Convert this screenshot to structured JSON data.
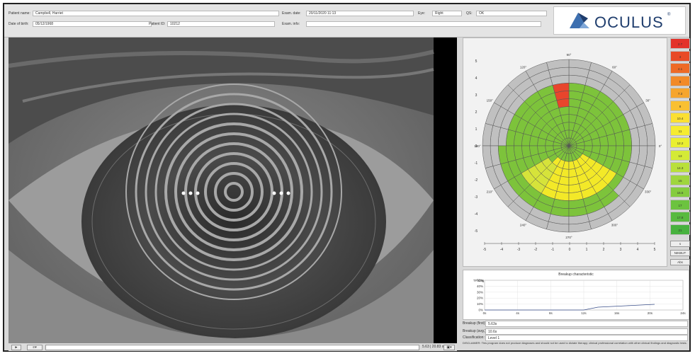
{
  "header": {
    "patient_name_label": "Patient name:",
    "patient_name": "Campbell, Harriet",
    "dob_label": "Date of birth:",
    "dob": "05/12/1968",
    "patient_id_label": "Patient ID:",
    "patient_id": "10212",
    "exam_date_label": "Exam. date:",
    "exam_date": "20/11/2020 11:13",
    "eye_label": "Eye:",
    "eye": "Right",
    "qs_label": "QS:",
    "qs": "OK",
    "exam_info_label": "Exam. info:",
    "exam_info": ""
  },
  "logo": {
    "text": "OCULUS",
    "reg": "®"
  },
  "image_toolbar": {
    "play_label": "►",
    "menu_label": "≡▾",
    "info": "5.63 | 20.83 s",
    "save_label": "▣▾"
  },
  "map": {
    "angle_labels": [
      "0°",
      "30°",
      "60°",
      "90°",
      "120°",
      "150°",
      "180°",
      "210°",
      "240°",
      "270°",
      "300°",
      "330°"
    ],
    "axis_ticks": [
      "-5",
      "-4",
      "-3",
      "-2",
      "-1",
      "0",
      "1",
      "2",
      "3",
      "4",
      "5"
    ],
    "rings": 11,
    "sectors": 24,
    "zone_colors": {
      "red": "#e8452c",
      "green": "#7dc33b",
      "yellow": "#f3e928",
      "light_yellow": "#d6e33a",
      "grey": "#c0c0c0"
    }
  },
  "scale": {
    "items": [
      {
        "label": "2.7",
        "color": "#e3322a"
      },
      {
        "label": "3",
        "color": "#e84a26"
      },
      {
        "label": "4.1",
        "color": "#ee6a26"
      },
      {
        "label": "5",
        "color": "#f28a28"
      },
      {
        "label": "7.3",
        "color": "#f6a52d"
      },
      {
        "label": "8",
        "color": "#f9c032"
      },
      {
        "label": "10.4",
        "color": "#fbe033"
      },
      {
        "label": "11",
        "color": "#f6ec30"
      },
      {
        "label": "12.2",
        "color": "#eaef30"
      },
      {
        "label": "13",
        "color": "#d4ea36"
      },
      {
        "label": "14.3",
        "color": "#b9e03b"
      },
      {
        "label": "15",
        "color": "#9fd63d"
      },
      {
        "label": "16.5",
        "color": "#85cc3e"
      },
      {
        "label": "17",
        "color": "#6cc33f"
      },
      {
        "label": "17.8",
        "color": "#58ba3f"
      },
      {
        "label": "21",
        "color": "#47b23e"
      }
    ],
    "buttons": [
      "s",
      "NIKBUT",
      "Abs"
    ]
  },
  "breakup": {
    "title": "Breakup characteristic",
    "ylabel": "TF-Dag",
    "y_ticks": [
      "50%",
      "40%",
      "30%",
      "20%",
      "10%",
      "0%"
    ],
    "x_ticks": [
      "0s",
      "4s",
      "8s",
      "12s",
      "16s",
      "20s",
      "24s"
    ]
  },
  "results": {
    "first_label": "Breakup (first):",
    "first_value": "5.63s",
    "avg_label": "Breakup (avg.):",
    "avg_value": "10.6s",
    "class_label": "Classification:",
    "class_value": "Level 1",
    "disclaimer": "DISCLAIMER: This program does not produce diagnoses and should not be used to dictate therapy; clinical professional correlation with other clinical findings and diagnostic tests."
  }
}
